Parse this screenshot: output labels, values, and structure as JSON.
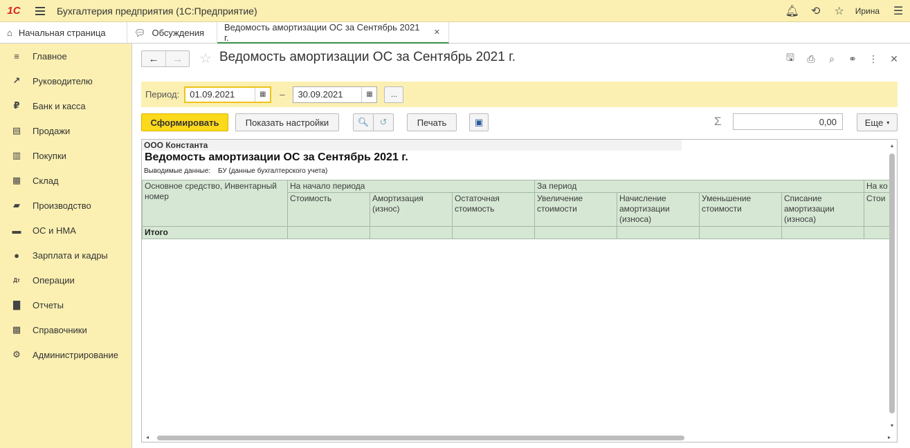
{
  "app": {
    "logo": "1С",
    "title": "Бухгалтерия предприятия (1С:Предприятие)",
    "user": "Ирина"
  },
  "tabs": [
    {
      "label": "Начальная страница",
      "icon": "home-icon"
    },
    {
      "label": "Обсуждения",
      "icon": "chat-icon"
    },
    {
      "label": "Ведомость амортизации ОС за Сентябрь 2021 г.",
      "icon": "",
      "active": true
    }
  ],
  "sidebar": {
    "items": [
      {
        "label": "Главное",
        "icon": "list-icon"
      },
      {
        "label": "Руководителю",
        "icon": "trend-icon"
      },
      {
        "label": "Банк и касса",
        "icon": "ruble-icon"
      },
      {
        "label": "Продажи",
        "icon": "bag-icon"
      },
      {
        "label": "Покупки",
        "icon": "cart-icon"
      },
      {
        "label": "Склад",
        "icon": "grid-icon"
      },
      {
        "label": "Производство",
        "icon": "factory-icon"
      },
      {
        "label": "ОС и НМА",
        "icon": "truck-icon"
      },
      {
        "label": "Зарплата и кадры",
        "icon": "person-icon"
      },
      {
        "label": "Операции",
        "icon": "dt-kt-icon"
      },
      {
        "label": "Отчеты",
        "icon": "bar-chart-icon"
      },
      {
        "label": "Справочники",
        "icon": "book-icon"
      },
      {
        "label": "Администрирование",
        "icon": "gear-icon"
      }
    ]
  },
  "document": {
    "title": "Ведомость амортизации ОС за Сентябрь 2021 г."
  },
  "period": {
    "label": "Период:",
    "from": "01.09.2021",
    "dash": "–",
    "to": "30.09.2021",
    "more": "..."
  },
  "toolbar": {
    "generate": "Сформировать",
    "show_settings": "Показать настройки",
    "print": "Печать",
    "sigma": "Σ",
    "sum_value": "0,00",
    "more": "Еще"
  },
  "report": {
    "org": "ООО Константа",
    "title": "Ведомость амортизации ОС за Сентябрь 2021 г.",
    "output_label": "Выводимые данные:",
    "output_value": "БУ (данные бухгалтерского учета)",
    "headers": {
      "asset": "Основное средство, Инвентарный номер",
      "start": "На начало периода",
      "period": "За период",
      "end": "На ко",
      "cost": "Стоимость",
      "depreciation": "Амортизация (износ)",
      "residual": "Остаточная стоимость",
      "increase": "Увеличение стоимости",
      "accrual": "Начисление амортизации (износа)",
      "decrease": "Уменьшение стоимости",
      "writeoff": "Списание амортизации (износа)",
      "end_cost": "Стои"
    },
    "total": "Итого"
  }
}
